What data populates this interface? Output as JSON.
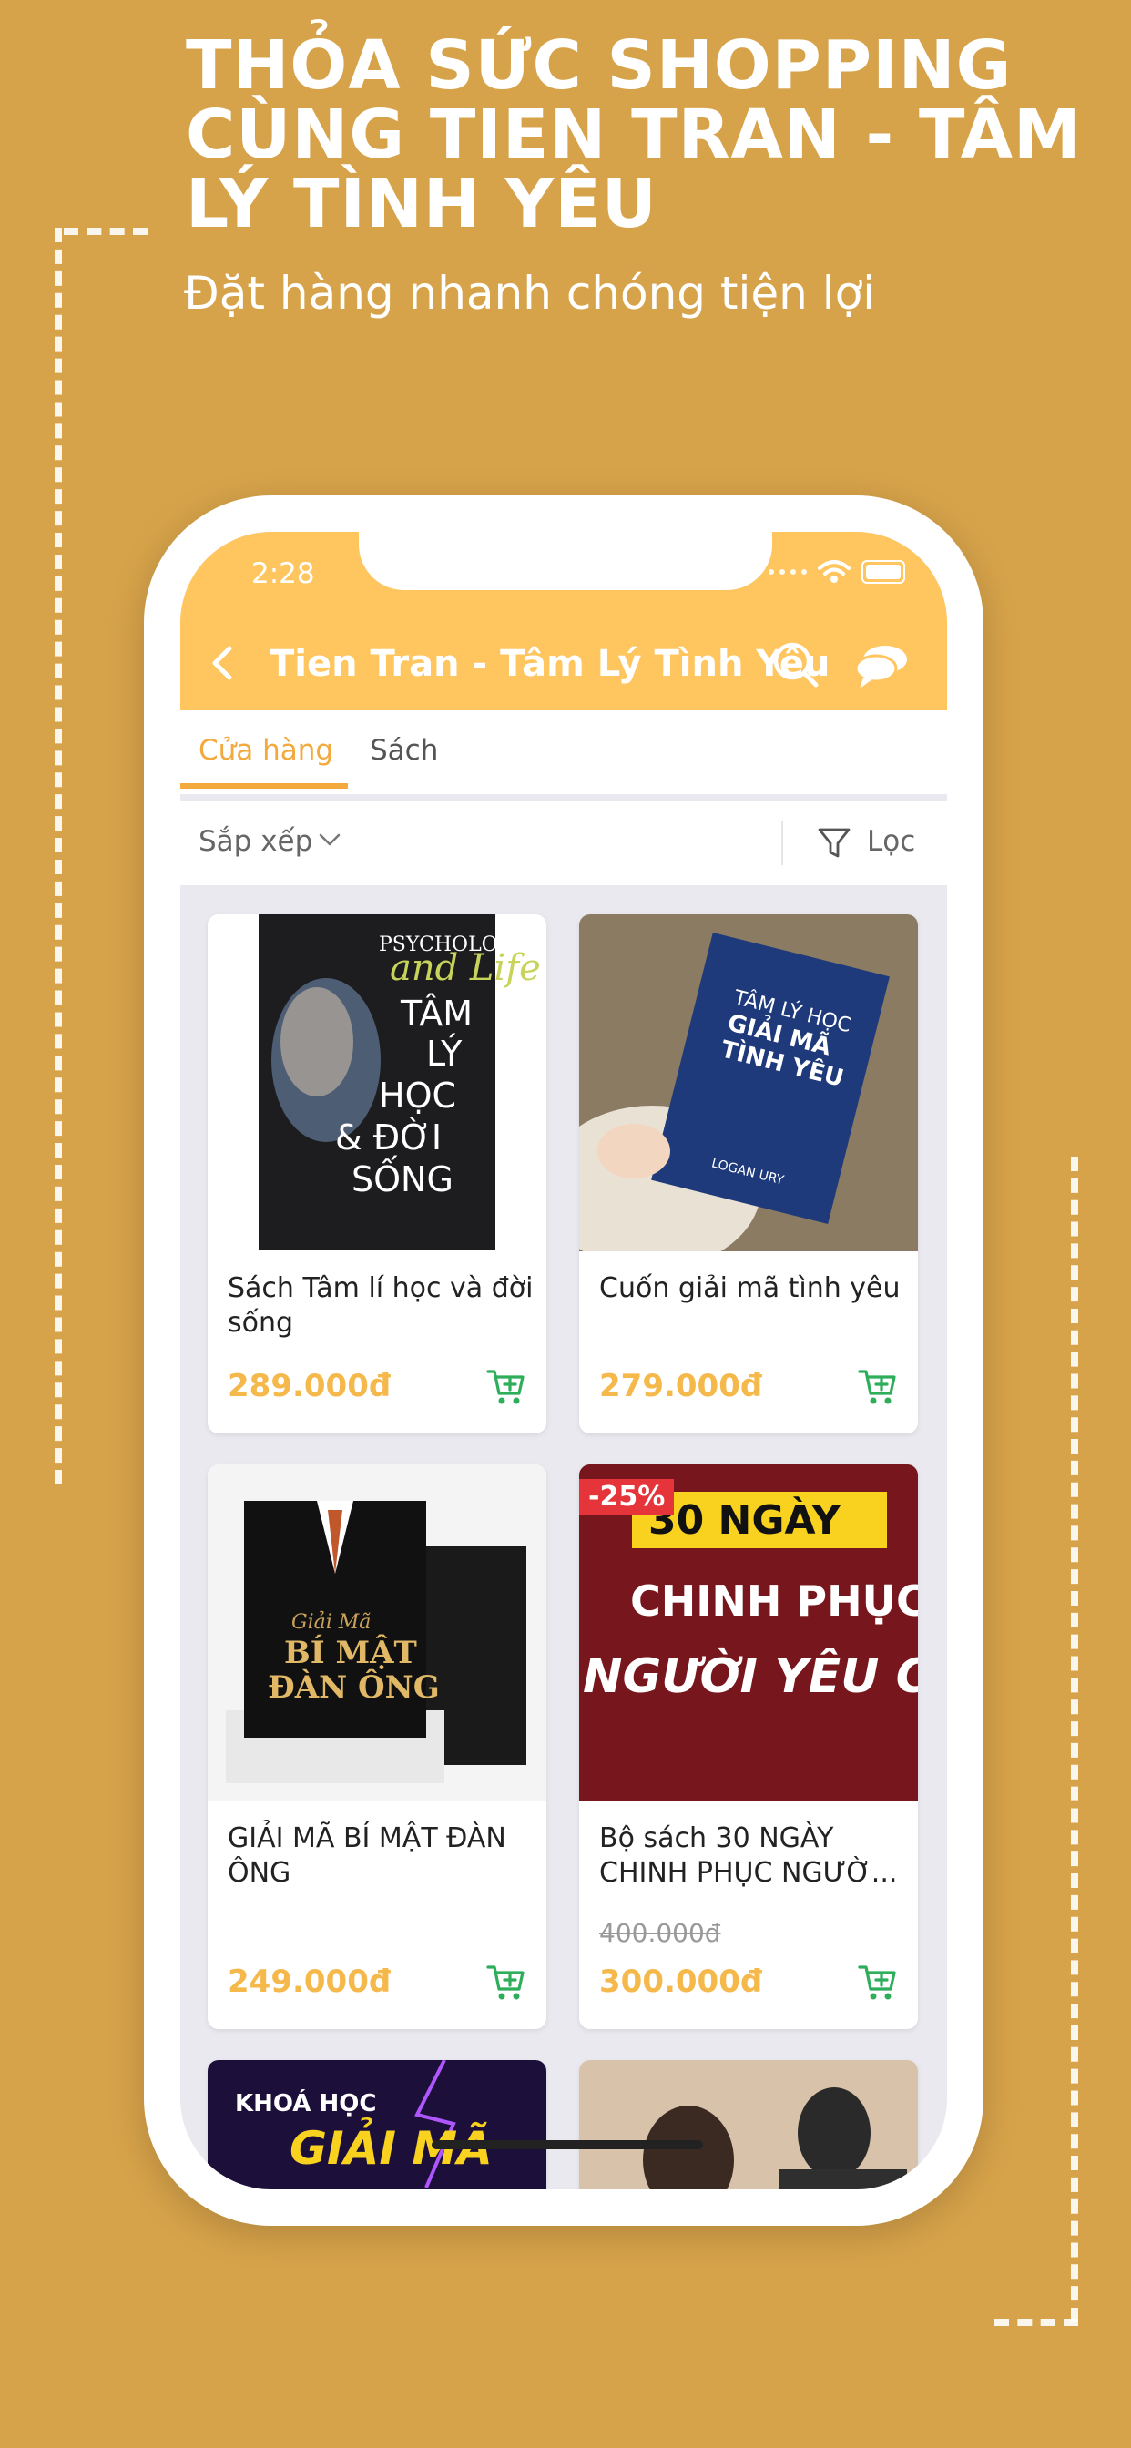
{
  "promo": {
    "headline": "THỎA SỨC SHOPPING CÙNG TIEN TRAN - TÂM LÝ TÌNH YÊU",
    "subheadline": "Đặt hàng nhanh chóng tiện lợi"
  },
  "status_bar": {
    "time": "2:28"
  },
  "header": {
    "title": "Tien Tran - Tâm Lý Tình Yêu",
    "icons": [
      "back-chevron-icon",
      "search-icon",
      "chat-icon"
    ]
  },
  "tabs": [
    {
      "label": "Cửa hàng",
      "active": true
    },
    {
      "label": "Sách",
      "active": false
    }
  ],
  "toolbar": {
    "sort_label": "Sắp xếp",
    "filter_label": "Lọc"
  },
  "products": [
    {
      "name": "Sách Tâm lí học và đời sống",
      "price": "289.000đ",
      "cover_lines": [
        "PSYCHOLOGY",
        "and Life",
        "TÂM",
        "LÝ",
        "HỌC",
        "& ĐỜI",
        "SỐNG"
      ]
    },
    {
      "name": "Cuốn giải mã tình yêu",
      "price": "279.000đ",
      "cover_lines": [
        "TÂM LÝ HỌC",
        "GIẢI MÃ",
        "TÌNH YÊU",
        "LOGAN URY"
      ]
    },
    {
      "name": "GIẢI MÃ BÍ MẬT ĐÀN ÔNG",
      "price": "249.000đ",
      "cover_lines": [
        "Giải Mã",
        "BÍ MẬT",
        "ĐÀN ÔNG"
      ]
    },
    {
      "name": "Bộ sách 30 NGÀY CHINH PHỤC NGƯỜ...",
      "price": "300.000đ",
      "old_price": "400.000đ",
      "discount": "-25%",
      "cover_lines": [
        "30 NGÀY",
        "CHINH PHỤC",
        "NGƯỜI YÊU CŨ"
      ]
    },
    {
      "name": "",
      "price": "",
      "cover_lines": [
        "KHOÁ HỌC",
        "GIẢI MÃ"
      ]
    },
    {
      "name": "",
      "price": "",
      "cover_lines": []
    }
  ],
  "colors": {
    "background": "#D7A34A",
    "header": "#FFC55E",
    "accent": "#F3A93B",
    "price": "#F5B84A",
    "cart_icon": "#2EAD5B",
    "badge": "#E5343A"
  }
}
